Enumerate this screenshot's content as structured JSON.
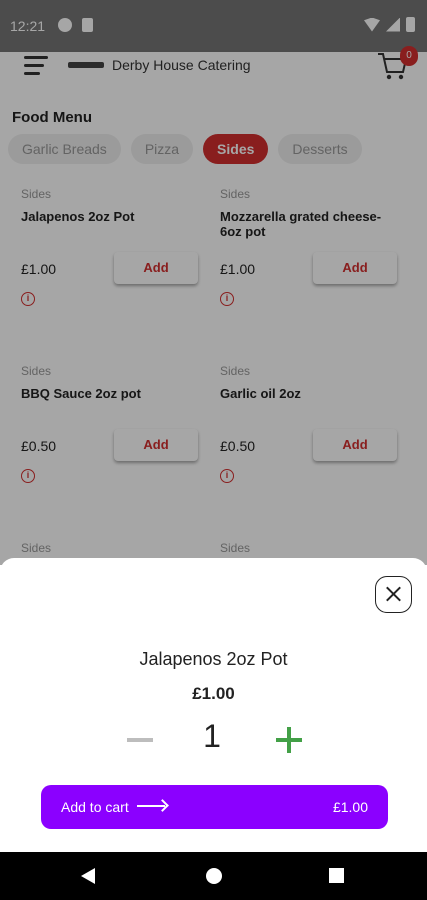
{
  "status_bar": {
    "time": "12:21",
    "icons": [
      "notification-icon",
      "sim-icon",
      "wifi-icon",
      "cell-signal-icon",
      "battery-icon"
    ]
  },
  "app_bar": {
    "brand_name": "Derby House Catering",
    "cart_count": "0"
  },
  "menu": {
    "title": "Food Menu",
    "categories": [
      {
        "label": "Garlic Breads",
        "active": false
      },
      {
        "label": "Pizza",
        "active": false
      },
      {
        "label": "Sides",
        "active": true
      },
      {
        "label": "Desserts",
        "active": false
      }
    ],
    "items": [
      {
        "category": "Sides",
        "name": "Jalapenos 2oz Pot",
        "price": "£1.00",
        "add_label": "Add"
      },
      {
        "category": "Sides",
        "name": "Mozzarella grated cheese-6oz pot",
        "price": "£1.00",
        "add_label": "Add"
      },
      {
        "category": "Sides",
        "name": "BBQ Sauce 2oz pot",
        "price": "£0.50",
        "add_label": "Add"
      },
      {
        "category": "Sides",
        "name": "Garlic oil 2oz",
        "price": "£0.50",
        "add_label": "Add"
      },
      {
        "category": "Sides"
      },
      {
        "category": "Sides"
      }
    ],
    "info_glyph": "i"
  },
  "sheet": {
    "item_name": "Jalapenos 2oz Pot",
    "item_price": "£1.00",
    "quantity": "1",
    "add_to_cart_label": "Add to cart",
    "total": "£1.00"
  },
  "colors": {
    "accent_red": "#d32f2f",
    "cta_purple": "#8b00ff",
    "plus_green": "#43a047"
  }
}
